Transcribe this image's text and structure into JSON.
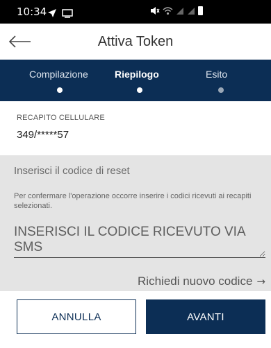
{
  "status_bar": {
    "time": "10:34",
    "left_icons": [
      "navigation-icon",
      "cast-icon"
    ],
    "right_icons": [
      "mute-icon",
      "wifi-icon",
      "signal-icon",
      "signal-icon",
      "battery-icon"
    ]
  },
  "app_bar": {
    "title": "Attiva Token",
    "back_icon": "arrow-left-icon"
  },
  "stepper": {
    "steps": [
      {
        "label": "Compilazione",
        "state": "done"
      },
      {
        "label": "Riepilogo",
        "state": "current"
      },
      {
        "label": "Esito",
        "state": "pending"
      }
    ]
  },
  "contact": {
    "label": "RECAPITO CELLULARE",
    "value": "349/*****57"
  },
  "reset_code": {
    "title": "Inserisci il codice di reset",
    "description": "Per confermare l'operazione occorre inserire i codici ricevuti ai recapiti selezionati.",
    "input_value": "",
    "input_placeholder": "INSERISCI IL CODICE RICEVUTO VIA SMS",
    "resend_label": "Richiedi nuovo codice",
    "resend_icon": "arrow-right-icon"
  },
  "actions": {
    "cancel_label": "ANNULLA",
    "next_label": "AVANTI"
  },
  "colors": {
    "primary": "#0c2e55",
    "panel_bg": "#e4e4e4",
    "status_bar_bg": "#000000"
  }
}
